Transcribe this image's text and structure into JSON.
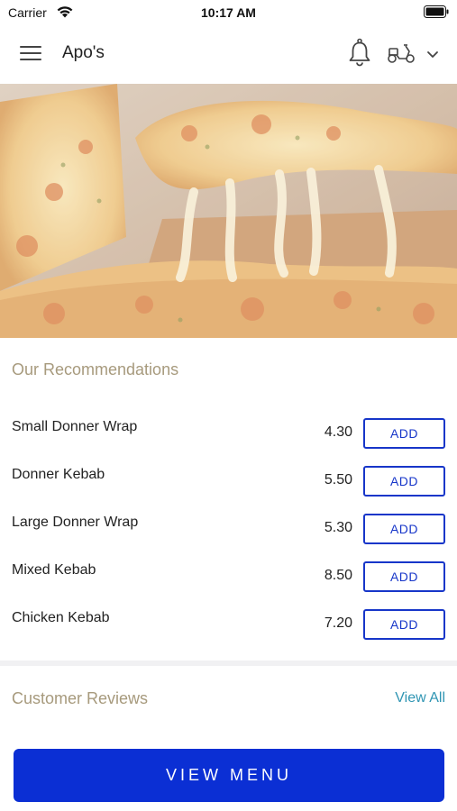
{
  "status_bar": {
    "carrier": "Carrier",
    "time": "10:17 AM"
  },
  "header": {
    "title": "Apo's",
    "icons": [
      "menu-icon",
      "bell-icon",
      "delivery-scooter-icon",
      "chevron-down-icon"
    ]
  },
  "hero": {
    "image": "cheese-pizza-slice-photo"
  },
  "recommendations": {
    "title": "Our Recommendations",
    "items": [
      {
        "name": "Small Donner Wrap",
        "price": "4.30",
        "action": "ADD"
      },
      {
        "name": "Donner Kebab",
        "price": "5.50",
        "action": "ADD"
      },
      {
        "name": "Large Donner Wrap",
        "price": "5.30",
        "action": "ADD"
      },
      {
        "name": "Mixed Kebab",
        "price": "8.50",
        "action": "ADD"
      },
      {
        "name": "Chicken Kebab",
        "price": "7.20",
        "action": "ADD"
      }
    ]
  },
  "reviews": {
    "title": "Customer Reviews",
    "view_all": "View All"
  },
  "footer": {
    "view_menu": "VIEW MENU"
  },
  "colors": {
    "accent_blue": "#0b2fd4",
    "section_title": "#a79a7d",
    "link": "#2f95b3"
  }
}
